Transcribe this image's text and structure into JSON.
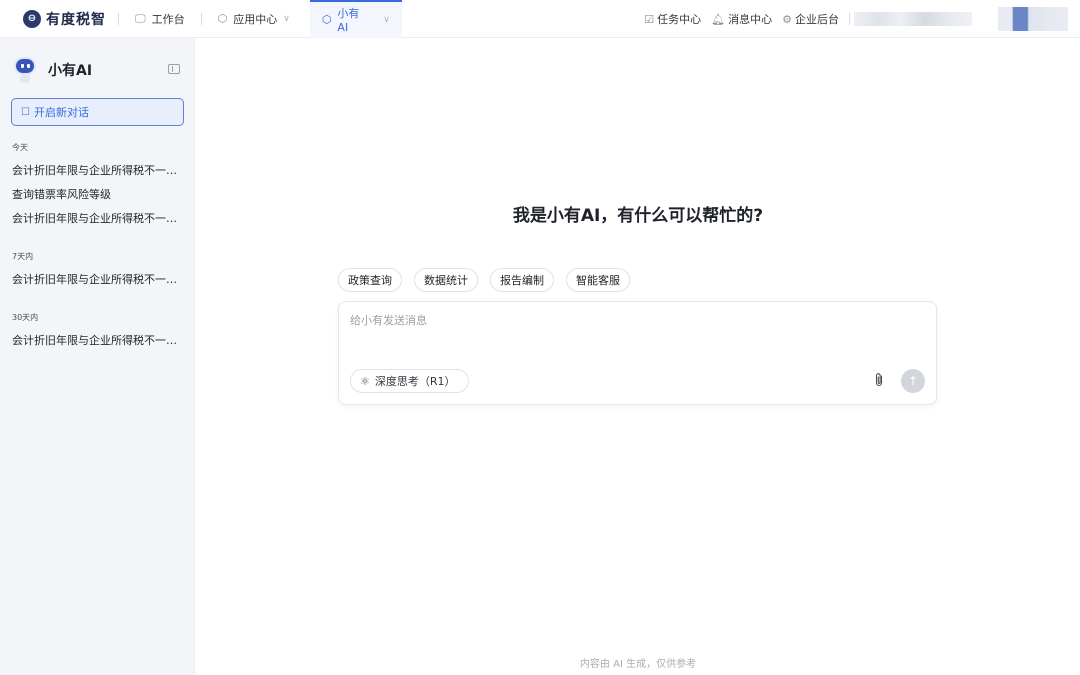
{
  "topbar": {
    "brand_name": "有度税智",
    "nav": [
      {
        "label": "工作台",
        "icon": "monitor-icon"
      },
      {
        "label": "应用中心",
        "icon": "cube-icon"
      },
      {
        "label": "小有AI",
        "icon": "cube-icon"
      }
    ],
    "right": [
      {
        "label": "任务中心",
        "icon": "calendar-icon"
      },
      {
        "label": "消息中心",
        "icon": "bell-icon"
      },
      {
        "label": "企业后台",
        "icon": "gear-icon"
      }
    ]
  },
  "sidebar": {
    "title": "小有AI",
    "new_chat_label": "开启新对话",
    "groups": [
      {
        "label": "今天",
        "items": [
          "会计折旧年限与企业所得税不一致…",
          "查询错票率风险等级",
          "会计折旧年限与企业所得税不一致…"
        ]
      },
      {
        "label": "7天内",
        "items": [
          "会计折旧年限与企业所得税不一致…"
        ]
      },
      {
        "label": "30天内",
        "items": [
          "会计折旧年限与企业所得税不一致…"
        ]
      }
    ]
  },
  "main": {
    "greeting": "我是小有AI，有什么可以帮忙的?",
    "chips": [
      "政策查询",
      "数据统计",
      "报告编制",
      "智能客服"
    ],
    "input_placeholder": "给小有发送消息",
    "deep_think_label": "深度思考（R1）",
    "disclaimer": "内容由 AI 生成，仅供参考"
  },
  "colors": {
    "accent": "#3b6be0",
    "sidebar_bg": "#f3f5f9",
    "brand_dark": "#2b3a6b"
  }
}
